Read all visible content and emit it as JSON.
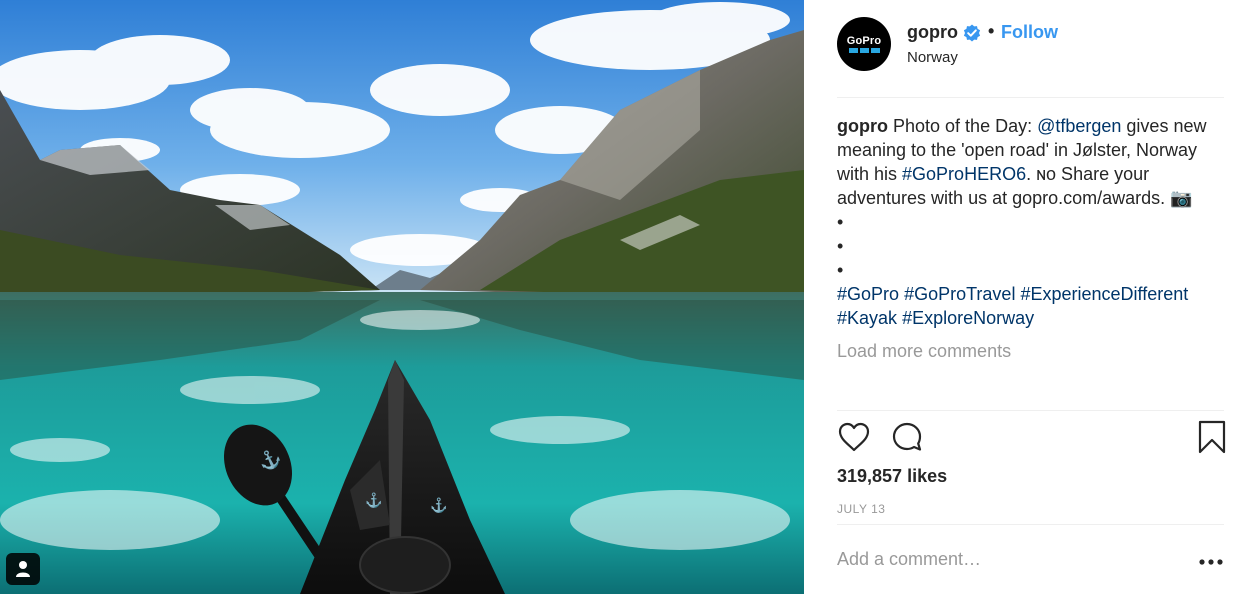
{
  "post": {
    "author": {
      "username": "gopro",
      "location": "Norway",
      "follow_label": "Follow",
      "separator": "•",
      "avatar_logo_text": "GoPro",
      "verified_icon": "verified-badge-icon"
    },
    "caption": {
      "username": "gopro",
      "text_1": " Photo of the Day: ",
      "mention": "@tfbergen",
      "text_2": " gives new meaning to the 'open road' in Jølster, Norway with his ",
      "hashtag_inline": "#GoProHERO6",
      "text_3": ". ɴᴏ Share your adventures with us at gopro.com/awards. 📷",
      "bullets": [
        "•",
        "•",
        "•"
      ],
      "hashtags": [
        "#GoPro",
        "#GoProTravel",
        "#ExperienceDifferent",
        "#Kayak",
        "#ExploreNorway"
      ]
    },
    "load_more_label": "Load more comments",
    "likes_label": "319,857 likes",
    "date_label": "JULY 13",
    "comment_input_placeholder": "Add a comment…",
    "more_options_label": "•••"
  },
  "colors": {
    "accent_link": "#3897f0",
    "hashtag": "#003569",
    "muted": "#999999",
    "text": "#262626"
  }
}
